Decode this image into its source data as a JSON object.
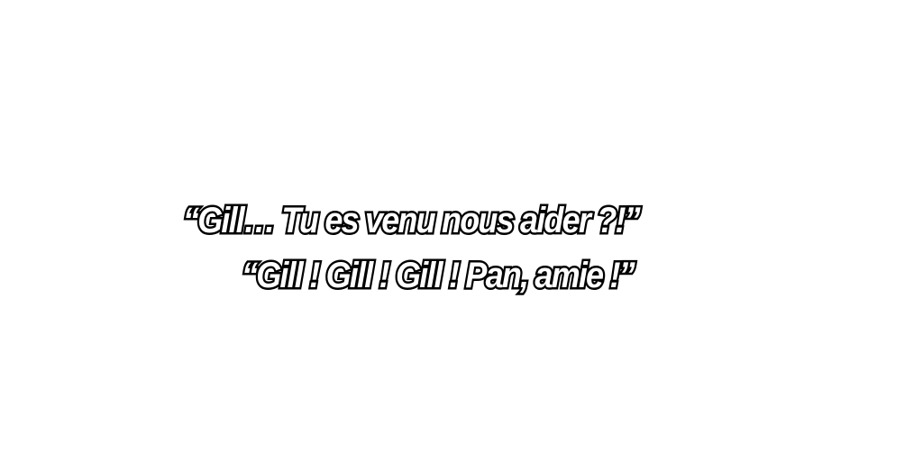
{
  "caption": {
    "line1": "“Gill… Tu es venu nous aider ?!”",
    "line2": "“Gill ! Gill ! Gill ! Pan, amie !”"
  },
  "colors": {
    "background": "#ffffff",
    "text_fill": "#ffffff",
    "text_outline": "#000000"
  }
}
